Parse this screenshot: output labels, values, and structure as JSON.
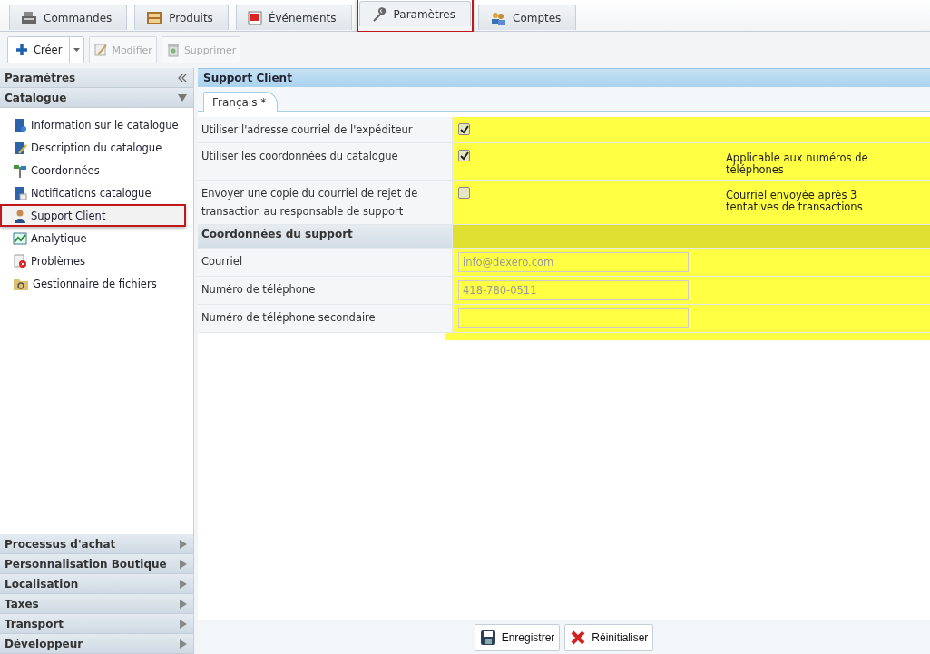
{
  "tabs": [
    {
      "label": "Commandes",
      "selected": false,
      "annotated": false
    },
    {
      "label": "Produits",
      "selected": false,
      "annotated": false
    },
    {
      "label": "Événements",
      "selected": false,
      "annotated": false
    },
    {
      "label": "Paramètres",
      "selected": true,
      "annotated": true
    },
    {
      "label": "Comptes",
      "selected": false,
      "annotated": false
    }
  ],
  "toolbar": [
    {
      "label": "Créer",
      "kind": "split"
    },
    {
      "label": "Modifier",
      "kind": "plain",
      "disabled": true
    },
    {
      "label": "Supprimer",
      "kind": "plain",
      "disabled": true
    }
  ],
  "sidebar": {
    "title": "Paramètres",
    "group": {
      "title": "Catalogue",
      "expanded": true,
      "items": [
        {
          "label": "Information sur le catalogue",
          "selected": false,
          "annotated": false
        },
        {
          "label": "Description du catalogue",
          "selected": false,
          "annotated": false
        },
        {
          "label": "Coordonnées",
          "selected": false,
          "annotated": false
        },
        {
          "label": "Notifications catalogue",
          "selected": false,
          "annotated": false
        },
        {
          "label": "Support Client",
          "selected": true,
          "annotated": true
        },
        {
          "label": "Analytique",
          "selected": false,
          "annotated": false
        },
        {
          "label": "Problèmes",
          "selected": false,
          "annotated": false
        },
        {
          "label": "Gestionnaire de fichiers",
          "selected": false,
          "annotated": false
        }
      ]
    },
    "collapsed_groups": [
      {
        "title": "Processus d'achat",
        "expanded": false
      },
      {
        "title": "Personnalisation Boutique",
        "expanded": false
      },
      {
        "title": "Localisation",
        "expanded": false
      },
      {
        "title": "Taxes",
        "expanded": false
      },
      {
        "title": "Transport",
        "expanded": false
      },
      {
        "title": "Développeur",
        "expanded": false
      }
    ]
  },
  "panel": {
    "title": "Support Client",
    "language_tab": {
      "label": "Français *"
    },
    "options": [
      {
        "label": "Utiliser l'adresse courriel de l'expéditeur",
        "checked": true
      },
      {
        "label": "Utiliser les coordonnées du catalogue",
        "checked": true,
        "note": "Applicable aux numéros de téléphones"
      },
      {
        "label": "Envoyer une copie du courriel de rejet de transaction au responsable de support",
        "checked": false,
        "note": "Courriel envoyée après 3 tentatives de transactions"
      }
    ],
    "section": "Coordonnées du support",
    "fields": [
      {
        "label": "Courriel",
        "placeholder": "info@dexero.com"
      },
      {
        "label": "Numéro de téléphone",
        "placeholder": "418-780-0511"
      },
      {
        "label": "Numéro de téléphone secondaire"
      }
    ],
    "highlighted": true
  },
  "footer": {
    "buttons": [
      {
        "label": "Enregistrer",
        "kind": "save"
      },
      {
        "label": "Réinitialiser",
        "kind": "reset"
      }
    ]
  }
}
